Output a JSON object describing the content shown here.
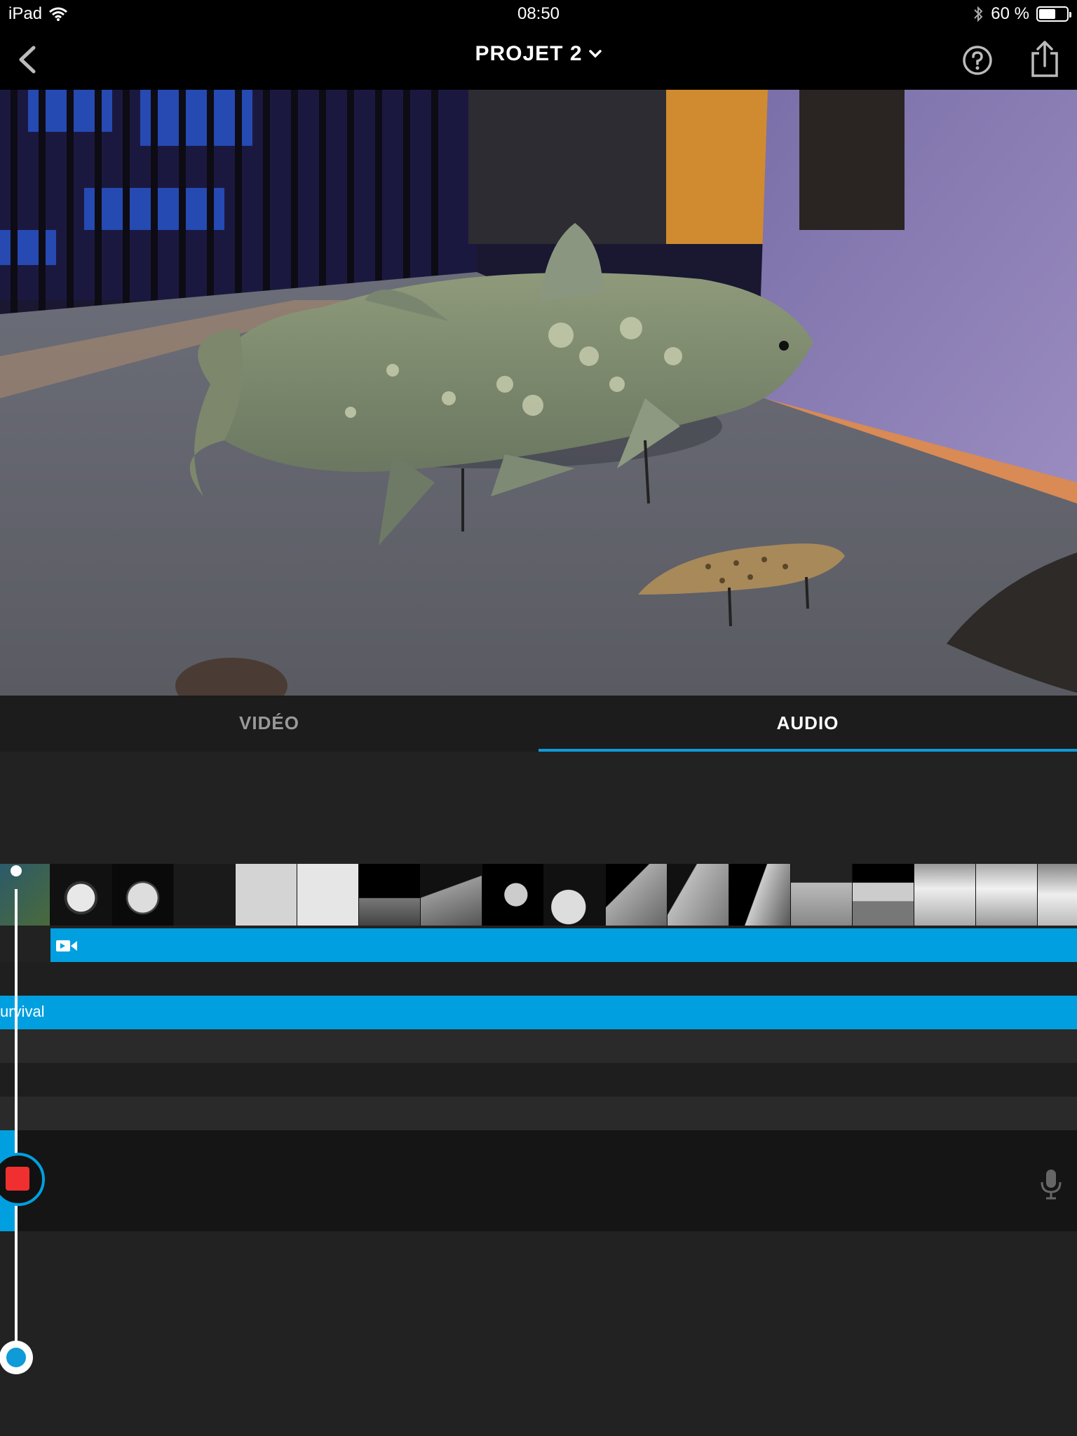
{
  "status_bar": {
    "device": "iPad",
    "time": "08:50",
    "battery_text": "60 %",
    "battery_level": 0.6,
    "icons": [
      "wifi-icon",
      "bluetooth-icon",
      "battery-icon"
    ]
  },
  "nav": {
    "title": "PROJET 2",
    "icons": [
      "back-chevron-icon",
      "chevron-down-icon",
      "help-icon",
      "share-icon"
    ]
  },
  "tabs": [
    {
      "label": "VIDÉO",
      "active": false
    },
    {
      "label": "AUDIO",
      "active": true
    }
  ],
  "timeline": {
    "music_track_label": "urvival",
    "clip_icon": "video-camera-icon",
    "record_icon": "stop-record-icon",
    "mic_icon": "microphone-icon"
  },
  "colors": {
    "accent": "#00a0e0",
    "record": "#f03030",
    "background": "#222222"
  }
}
